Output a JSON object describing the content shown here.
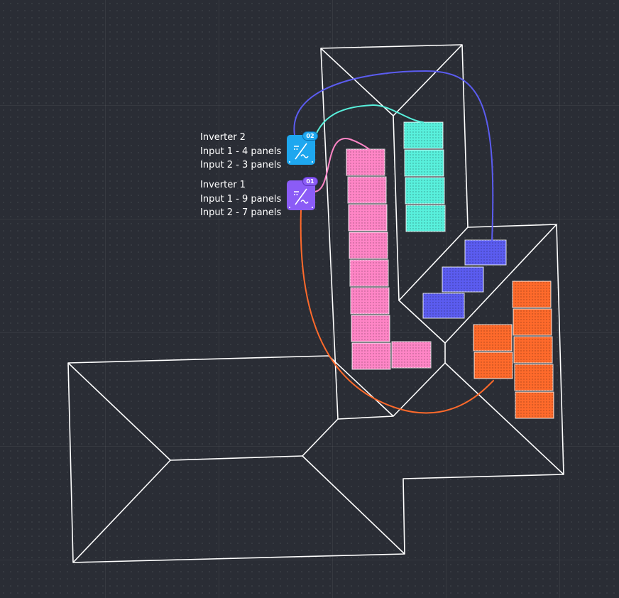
{
  "inverters": [
    {
      "title": "Inverter 2",
      "badge": "02",
      "inputs": [
        "Input 1 - 4 panels",
        "Input 2 - 3 panels"
      ],
      "color": "#1ea7ef",
      "badge_border": "#0b6fae"
    },
    {
      "title": "Inverter 1",
      "badge": "01",
      "inputs": [
        "Input 1 - 9 panels",
        "Input 2 - 7 panels"
      ],
      "color": "#8b5cf6",
      "badge_border": "#5b34b8"
    }
  ],
  "strings": [
    {
      "id": "inverter1-input1",
      "color": "#ff85c6",
      "panel_count": 9
    },
    {
      "id": "inverter1-input2",
      "color": "#ff6a2b",
      "panel_count": 7
    },
    {
      "id": "inverter2-input1",
      "color": "#58f0dc",
      "panel_count": 4
    },
    {
      "id": "inverter2-input2",
      "color": "#5b5cf0",
      "panel_count": 3
    }
  ],
  "colors": {
    "background": "#2a2d35",
    "roof_outline": "#ffffff"
  }
}
